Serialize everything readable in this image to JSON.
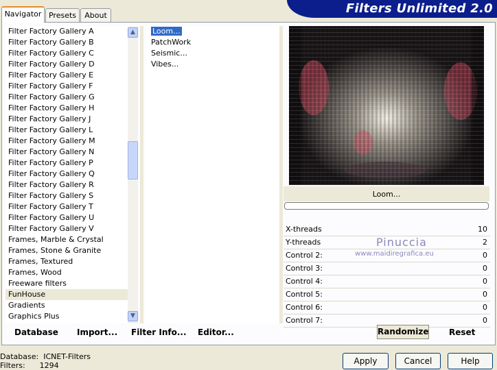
{
  "tabs": [
    "Navigator",
    "Presets",
    "About"
  ],
  "banner": "Filters Unlimited 2.0",
  "categories": [
    "Filter Factory Gallery A",
    "Filter Factory Gallery B",
    "Filter Factory Gallery C",
    "Filter Factory Gallery D",
    "Filter Factory Gallery E",
    "Filter Factory Gallery F",
    "Filter Factory Gallery G",
    "Filter Factory Gallery H",
    "Filter Factory Gallery J",
    "Filter Factory Gallery L",
    "Filter Factory Gallery M",
    "Filter Factory Gallery N",
    "Filter Factory Gallery P",
    "Filter Factory Gallery Q",
    "Filter Factory Gallery R",
    "Filter Factory Gallery S",
    "Filter Factory Gallery T",
    "Filter Factory Gallery U",
    "Filter Factory Gallery V",
    "Frames, Marble & Crystal",
    "Frames, Stone & Granite",
    "Frames, Textured",
    "Frames, Wood",
    "Freeware filters",
    "FunHouse",
    "Gradients",
    "Graphics Plus"
  ],
  "selected_category": "FunHouse",
  "filters": [
    "Loom...",
    "PatchWork",
    "Seismic...",
    "Vibes..."
  ],
  "selected_filter": "Loom...",
  "preview_filter_name": "Loom...",
  "progress": 0,
  "controls": [
    {
      "label": "X-threads",
      "value": "10"
    },
    {
      "label": "Y-threads",
      "value": "2"
    },
    {
      "label": "Control 2:",
      "value": "0"
    },
    {
      "label": "Control 3:",
      "value": "0"
    },
    {
      "label": "Control 4:",
      "value": "0"
    },
    {
      "label": "Control 5:",
      "value": "0"
    },
    {
      "label": "Control 6:",
      "value": "0"
    },
    {
      "label": "Control 7:",
      "value": "0"
    }
  ],
  "watermark": {
    "line1": "Pinuccia",
    "line2": "www.maidiregrafica.eu"
  },
  "bottom": {
    "database": "Database",
    "import": "Import...",
    "filter_info": "Filter Info...",
    "editor": "Editor...",
    "randomize": "Randomize",
    "reset": "Reset"
  },
  "dialog": {
    "apply": "Apply",
    "cancel": "Cancel",
    "help": "Help"
  },
  "status": {
    "database_label": "Database:",
    "database_value": "ICNET-Filters",
    "filters_label": "Filters:",
    "filters_value": "1294"
  }
}
